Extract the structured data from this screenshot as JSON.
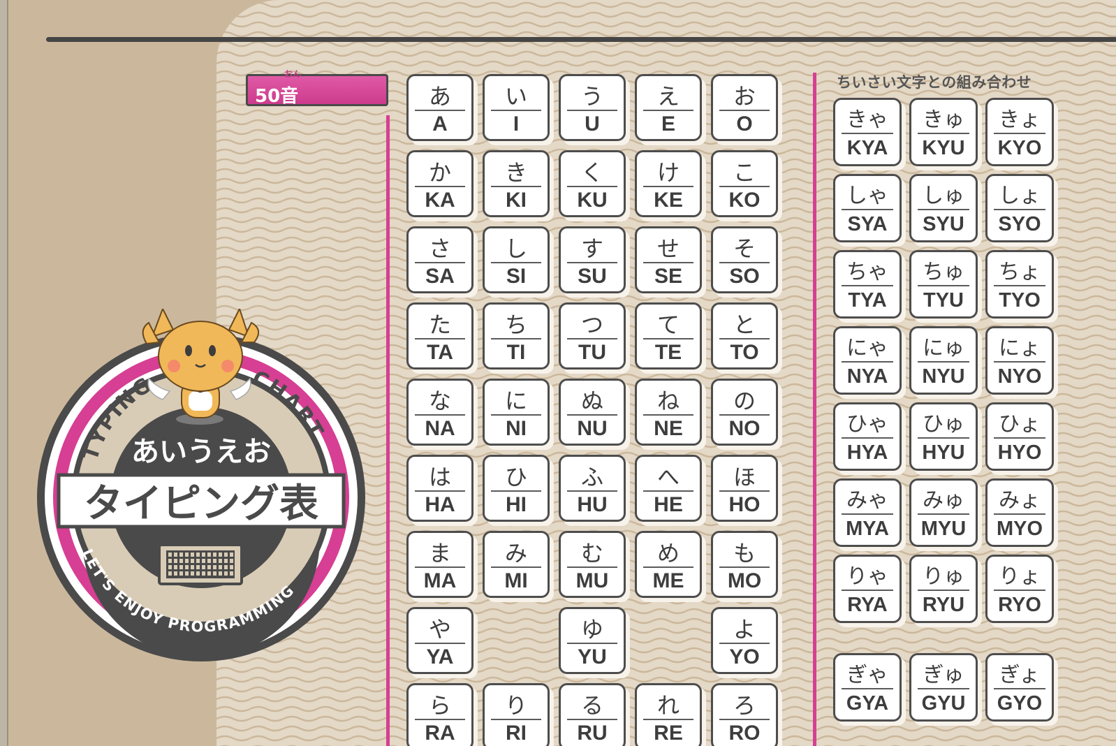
{
  "header": {
    "gojuon_label": "50音",
    "gojuon_ruby": "おん"
  },
  "small_section": {
    "title": "ちいさい文字との組み合わせ"
  },
  "badge": {
    "arc_left": "TYPING",
    "arc_right": "CHART",
    "title_kana": "あいうえお",
    "title_main": "タイピング表",
    "arc_bottom": "LET'S ENJOY PROGRAMMING"
  },
  "gojuon": [
    [
      {
        "kana": "あ",
        "roma": "A"
      },
      {
        "kana": "い",
        "roma": "I"
      },
      {
        "kana": "う",
        "roma": "U"
      },
      {
        "kana": "え",
        "roma": "E"
      },
      {
        "kana": "お",
        "roma": "O"
      }
    ],
    [
      {
        "kana": "か",
        "roma": "KA"
      },
      {
        "kana": "き",
        "roma": "KI"
      },
      {
        "kana": "く",
        "roma": "KU"
      },
      {
        "kana": "け",
        "roma": "KE"
      },
      {
        "kana": "こ",
        "roma": "KO"
      }
    ],
    [
      {
        "kana": "さ",
        "roma": "SA"
      },
      {
        "kana": "し",
        "roma": "SI"
      },
      {
        "kana": "す",
        "roma": "SU"
      },
      {
        "kana": "せ",
        "roma": "SE"
      },
      {
        "kana": "そ",
        "roma": "SO"
      }
    ],
    [
      {
        "kana": "た",
        "roma": "TA"
      },
      {
        "kana": "ち",
        "roma": "TI"
      },
      {
        "kana": "つ",
        "roma": "TU"
      },
      {
        "kana": "て",
        "roma": "TE"
      },
      {
        "kana": "と",
        "roma": "TO"
      }
    ],
    [
      {
        "kana": "な",
        "roma": "NA"
      },
      {
        "kana": "に",
        "roma": "NI"
      },
      {
        "kana": "ぬ",
        "roma": "NU"
      },
      {
        "kana": "ね",
        "roma": "NE"
      },
      {
        "kana": "の",
        "roma": "NO"
      }
    ],
    [
      {
        "kana": "は",
        "roma": "HA"
      },
      {
        "kana": "ひ",
        "roma": "HI"
      },
      {
        "kana": "ふ",
        "roma": "HU"
      },
      {
        "kana": "へ",
        "roma": "HE"
      },
      {
        "kana": "ほ",
        "roma": "HO"
      }
    ],
    [
      {
        "kana": "ま",
        "roma": "MA"
      },
      {
        "kana": "み",
        "roma": "MI"
      },
      {
        "kana": "む",
        "roma": "MU"
      },
      {
        "kana": "め",
        "roma": "ME"
      },
      {
        "kana": "も",
        "roma": "MO"
      }
    ],
    [
      {
        "kana": "や",
        "roma": "YA"
      },
      null,
      {
        "kana": "ゆ",
        "roma": "YU"
      },
      null,
      {
        "kana": "よ",
        "roma": "YO"
      }
    ],
    [
      {
        "kana": "ら",
        "roma": "RA"
      },
      {
        "kana": "り",
        "roma": "RI"
      },
      {
        "kana": "る",
        "roma": "RU"
      },
      {
        "kana": "れ",
        "roma": "RE"
      },
      {
        "kana": "ろ",
        "roma": "RO"
      }
    ]
  ],
  "youon": [
    [
      {
        "kana": "きゃ",
        "roma": "KYA"
      },
      {
        "kana": "きゅ",
        "roma": "KYU"
      },
      {
        "kana": "きょ",
        "roma": "KYO"
      }
    ],
    [
      {
        "kana": "しゃ",
        "roma": "SYA"
      },
      {
        "kana": "しゅ",
        "roma": "SYU"
      },
      {
        "kana": "しょ",
        "roma": "SYO"
      }
    ],
    [
      {
        "kana": "ちゃ",
        "roma": "TYA"
      },
      {
        "kana": "ちゅ",
        "roma": "TYU"
      },
      {
        "kana": "ちょ",
        "roma": "TYO"
      }
    ],
    [
      {
        "kana": "にゃ",
        "roma": "NYA"
      },
      {
        "kana": "にゅ",
        "roma": "NYU"
      },
      {
        "kana": "にょ",
        "roma": "NYO"
      }
    ],
    [
      {
        "kana": "ひゃ",
        "roma": "HYA"
      },
      {
        "kana": "ひゅ",
        "roma": "HYU"
      },
      {
        "kana": "ひょ",
        "roma": "HYO"
      }
    ],
    [
      {
        "kana": "みゃ",
        "roma": "MYA"
      },
      {
        "kana": "みゅ",
        "roma": "MYU"
      },
      {
        "kana": "みょ",
        "roma": "MYO"
      }
    ],
    [
      {
        "kana": "りゃ",
        "roma": "RYA"
      },
      {
        "kana": "りゅ",
        "roma": "RYU"
      },
      {
        "kana": "りょ",
        "roma": "RYO"
      }
    ],
    [
      {
        "kana": "ぎゃ",
        "roma": "GYA"
      },
      {
        "kana": "ぎゅ",
        "roma": "GYU"
      },
      {
        "kana": "ぎょ",
        "roma": "GYO"
      }
    ]
  ],
  "colors": {
    "accent": "#d63f93",
    "paper": "#e4d8c6",
    "tan": "#cbb89c",
    "ink": "#4a4a4a"
  }
}
